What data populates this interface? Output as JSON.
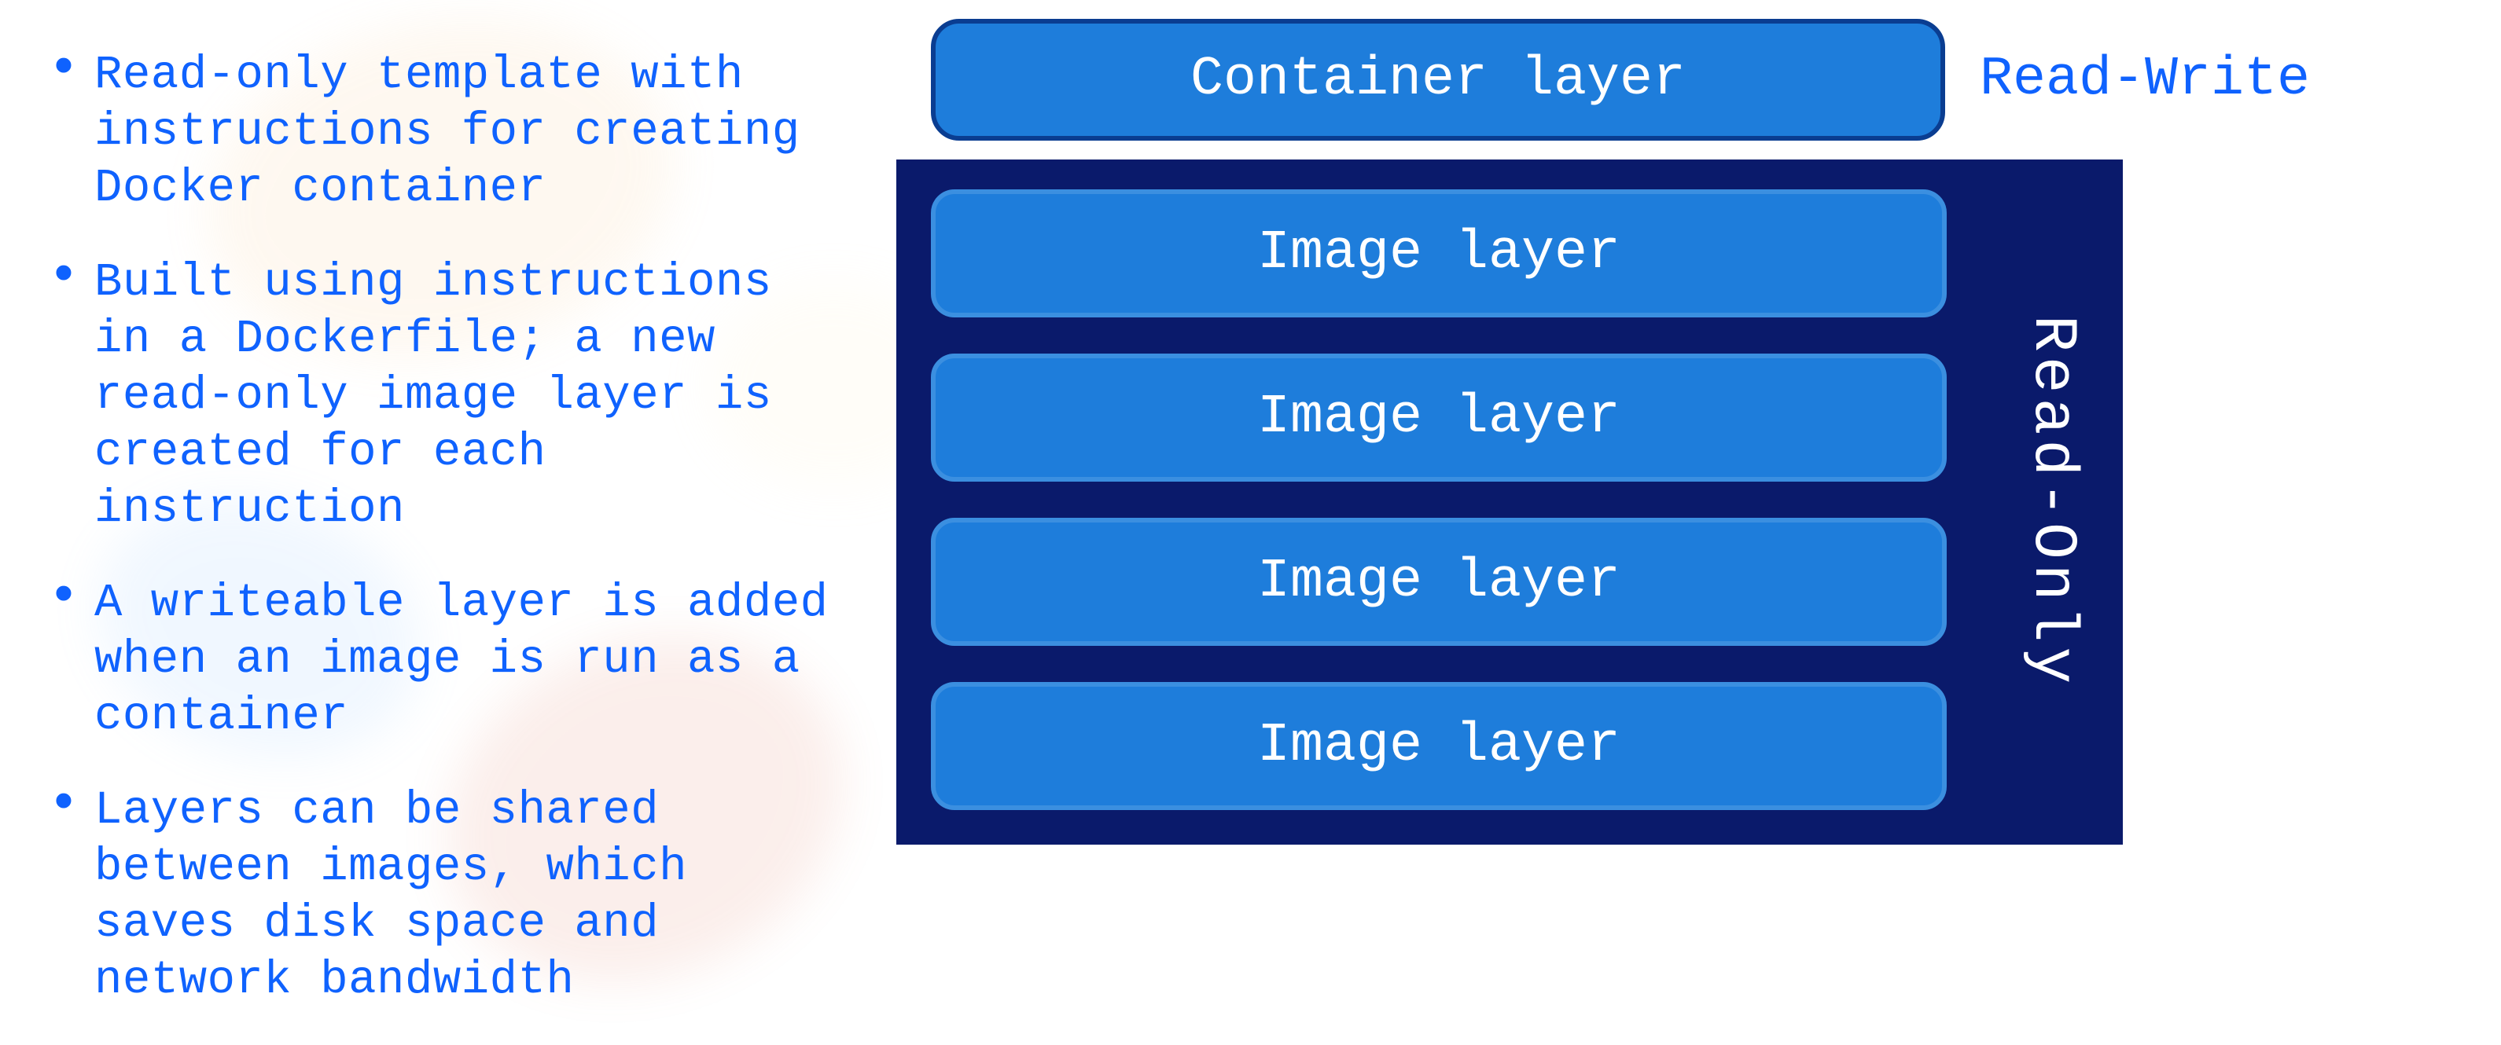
{
  "bullets": [
    "Read-only template with instructions for creating Docker container",
    "Built using instructions in a Dockerfile; a new read-only image layer is created for each instruction",
    "A writeable layer is added when an image is run as a container",
    "Layers can be shared between images, which saves disk space and network bandwidth"
  ],
  "diagram": {
    "container_layer": "Container layer",
    "read_write_label": "Read-Write",
    "image_layers": [
      "Image layer",
      "Image layer",
      "Image layer",
      "Image layer"
    ],
    "read_only_label": "Read-Only"
  }
}
